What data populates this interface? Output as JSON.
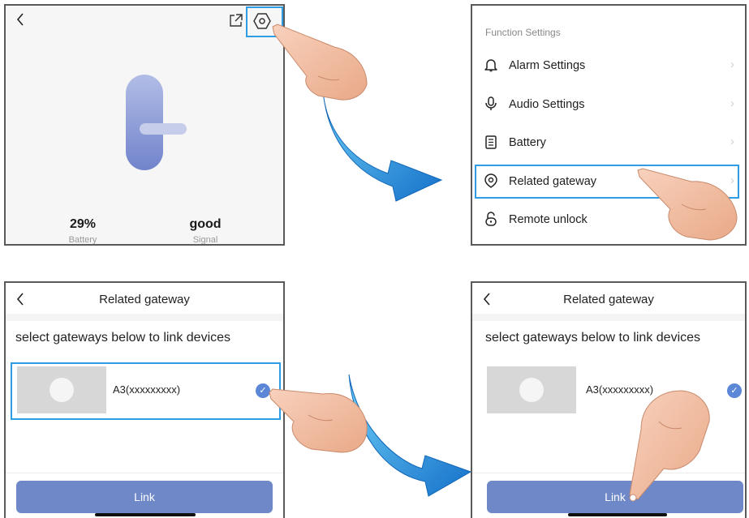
{
  "panel1": {
    "back_icon": "chevron-left-icon",
    "share_icon": "share-icon",
    "settings_icon": "settings-hexagon-icon",
    "battery_value": "29%",
    "battery_label": "Battery",
    "signal_value": "good",
    "signal_label": "Signal"
  },
  "panel2": {
    "section_title": "Function Settings",
    "items": [
      {
        "label": "Alarm Settings",
        "icon": "bell-icon"
      },
      {
        "label": "Audio Settings",
        "icon": "microphone-icon"
      },
      {
        "label": "Battery",
        "icon": "battery-icon"
      },
      {
        "label": "Related gateway",
        "icon": "gateway-pin-icon"
      },
      {
        "label": "Remote unlock",
        "icon": "unlock-icon"
      }
    ]
  },
  "panel3": {
    "title": "Related gateway",
    "instruction": "select gateways below to link devices",
    "gateway_name": "A3(xxxxxxxxx)",
    "link_label": "Link"
  },
  "panel4": {
    "title": "Related gateway",
    "instruction": "select gateways below to link devices",
    "gateway_name": "A3(xxxxxxxxx)",
    "link_label": "Link"
  },
  "colors": {
    "highlight": "#2f9de6",
    "arrow": "#1e9be8",
    "button": "#6e88c8",
    "check": "#5c86d6"
  }
}
